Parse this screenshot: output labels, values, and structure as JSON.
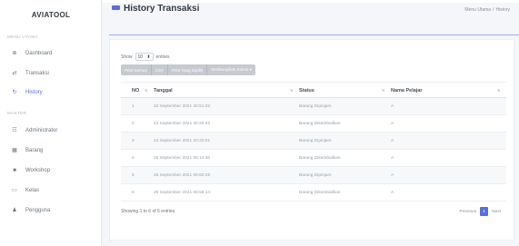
{
  "sidebar": {
    "brand": "AVIATOOL",
    "sections": [
      {
        "header": "MENU UTAMA",
        "items": [
          {
            "name": "dashboard",
            "icon": "dashboard-icon",
            "glyph": "⊕",
            "label": "Dashboard",
            "active": false
          },
          {
            "name": "transaksi",
            "icon": "transfer-icon",
            "glyph": "⇄",
            "label": "Transaksi",
            "active": false
          },
          {
            "name": "history",
            "icon": "history-icon",
            "glyph": "↻",
            "label": "History",
            "active": true
          }
        ]
      },
      {
        "header": "MASTER",
        "items": [
          {
            "name": "administrator",
            "icon": "users-icon",
            "glyph": "☷",
            "label": "Administrator",
            "active": false
          },
          {
            "name": "barang",
            "icon": "boxes-icon",
            "glyph": "▦",
            "label": "Barang",
            "active": false
          },
          {
            "name": "workshop",
            "icon": "building-icon",
            "glyph": "■",
            "label": "Workshop",
            "active": false
          },
          {
            "name": "kelas",
            "icon": "chalkboard-icon",
            "glyph": "▭",
            "label": "Kelas",
            "active": false
          },
          {
            "name": "pengguna",
            "icon": "user-icon",
            "glyph": "♟",
            "label": "Pengguna",
            "active": false
          }
        ]
      }
    ]
  },
  "header": {
    "title": "History Transaksi",
    "breadcrumb": [
      "Menu Utama",
      "History"
    ],
    "breadcrumb_sep": "/"
  },
  "controls": {
    "show_label": "Show",
    "page_size": "10",
    "entries_label": "entries",
    "buttons": [
      "Print Semua",
      "CSV",
      "Print Yang Dipilih",
      "Sembunyikan Kolom ▾"
    ]
  },
  "table": {
    "columns": [
      "NO",
      "Tanggal",
      "Status",
      "Nama Pelajar"
    ],
    "rows": [
      [
        "1",
        "22 September 2021 20:51:32",
        "Barang Dipinjam",
        "A"
      ],
      [
        "2",
        "24 September 2021 20:20:42",
        "Barang Dikembalikan",
        "A"
      ],
      [
        "3",
        "24 September 2021 20:33:01",
        "Barang Dipinjam",
        "A"
      ],
      [
        "4",
        "25 September 2021 06:13:30",
        "Barang Dikembalikan",
        "A"
      ],
      [
        "5",
        "25 September 2021 06:50:25",
        "Barang Dipinjam",
        "A"
      ],
      [
        "6",
        "25 September 2021 06:56:14",
        "Barang Dikembalikan",
        "A"
      ]
    ]
  },
  "footer": {
    "info": "Showing 1 to 6 of 6 entries",
    "previous": "Previous",
    "current_page": "1",
    "next": "Next"
  },
  "colors": {
    "accent": "#5a6fd8",
    "button_gray": "#c6c9ce"
  }
}
